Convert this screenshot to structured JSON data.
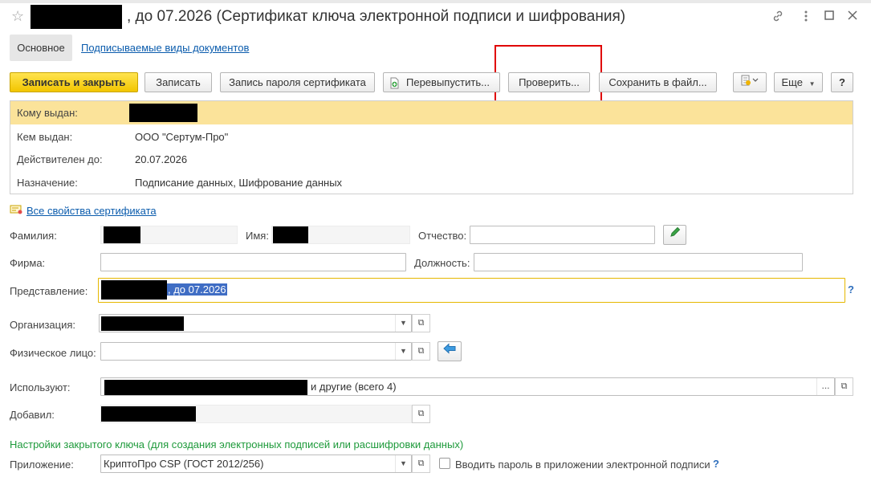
{
  "window": {
    "title": ", до 07.2026 (Сертификат ключа электронной подписи и шифрования)"
  },
  "tabs": {
    "main": "Основное",
    "signed_types": "Подписываемые виды документов"
  },
  "toolbar": {
    "save_close": "Записать и закрыть",
    "save": "Записать",
    "password": "Запись пароля сертификата",
    "reissue": "Перевыпустить...",
    "check": "Проверить...",
    "save_file": "Сохранить в файл...",
    "more": "Еще",
    "help": "?"
  },
  "info": {
    "issued_to_label": "Кому выдан:",
    "issued_by_label": "Кем выдан:",
    "issued_by": "ООО \"Сертум-Про\"",
    "valid_until_label": "Действителен до:",
    "valid_until": "20.07.2026",
    "purpose_label": "Назначение:",
    "purpose": "Подписание данных, Шифрование данных"
  },
  "all_props_link": "Все свойства сертификата",
  "form": {
    "surname_label": "Фамилия:",
    "name_label": "Имя:",
    "patronymic_label": "Отчество:",
    "company_label": "Фирма:",
    "position_label": "Должность:",
    "presentation_label": "Представление:",
    "presentation_value": ", до 07.2026",
    "organization_label": "Организация:",
    "person_label": "Физическое лицо:",
    "users_label": "Используют:",
    "users_value": "и другие (всего 4)",
    "added_label": "Добавил:",
    "more_dots": "...",
    "help_q": "?"
  },
  "private_key": {
    "section_title": "Настройки закрытого ключа (для создания электронных подписей или расшифровки данных)",
    "app_label": "Приложение:",
    "app_value": "КриптоПро CSP (ГОСТ 2012/256)",
    "password_checkbox_label": "Вводить пароль в приложении электронной подписи"
  },
  "icons": {
    "favorite": "star-icon",
    "link": "link-icon",
    "menu": "kebab-icon",
    "maximize": "maximize-icon",
    "close": "close-icon",
    "edit": "pencil-icon",
    "back": "arrow-left-icon",
    "open": "open-window-icon",
    "dropdown": "chevron-down-icon",
    "reissue": "document-plus-icon",
    "report": "report-icon",
    "properties": "certificate-icon"
  },
  "colors": {
    "primary_button": "#f2c500",
    "info_band": "#fbe39a",
    "link": "#0b5cad",
    "section_green": "#1e9a3b",
    "highlight_red": "#e00000",
    "active_field_border": "#e6b800"
  }
}
